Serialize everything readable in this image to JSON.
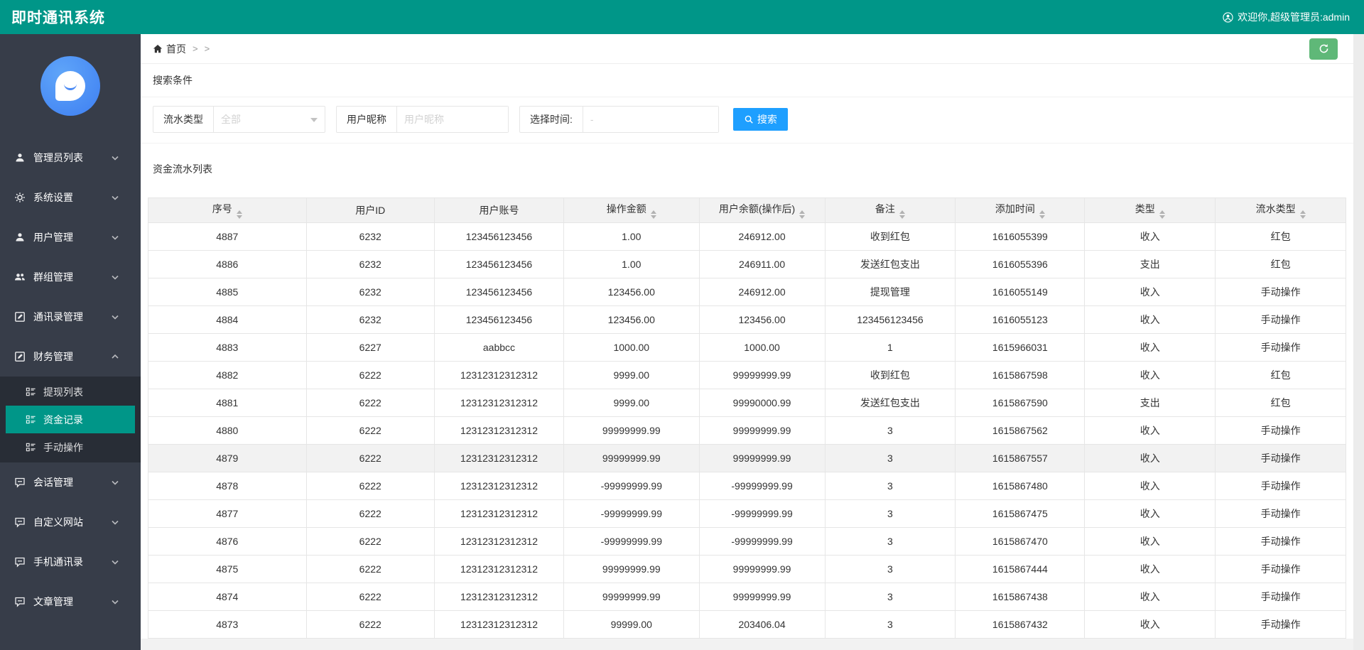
{
  "header": {
    "title": "即时通讯系统",
    "welcome": "欢迎你,超级管理员:admin"
  },
  "sidebar": {
    "menu": [
      {
        "id": "admin-list",
        "label": "管理员列表",
        "icon": "user-icon",
        "state": "collapsed"
      },
      {
        "id": "system-settings",
        "label": "系统设置",
        "icon": "gear-icon",
        "state": "collapsed"
      },
      {
        "id": "user-management",
        "label": "用户管理",
        "icon": "user-icon",
        "state": "collapsed"
      },
      {
        "id": "group-management",
        "label": "群组管理",
        "icon": "users-icon",
        "state": "collapsed"
      },
      {
        "id": "contacts-management",
        "label": "通讯录管理",
        "icon": "edit-icon",
        "state": "collapsed"
      },
      {
        "id": "finance-management",
        "label": "财务管理",
        "icon": "edit-icon",
        "state": "expanded",
        "children": [
          {
            "id": "withdraw-list",
            "label": "提现列表",
            "active": false
          },
          {
            "id": "fund-records",
            "label": "资金记录",
            "active": true
          },
          {
            "id": "manual-operation",
            "label": "手动操作",
            "active": false
          }
        ]
      },
      {
        "id": "session-management",
        "label": "会话管理",
        "icon": "comment-icon",
        "state": "collapsed"
      },
      {
        "id": "custom-website",
        "label": "自定义网站",
        "icon": "comment-icon",
        "state": "collapsed"
      },
      {
        "id": "phone-contacts",
        "label": "手机通讯录",
        "icon": "comment-icon",
        "state": "collapsed"
      },
      {
        "id": "article-management",
        "label": "文章管理",
        "icon": "comment-icon",
        "state": "collapsed"
      }
    ]
  },
  "breadcrumb": {
    "home": "首页",
    "separator": ">"
  },
  "search": {
    "panel_title": "搜索条件",
    "type_label": "流水类型",
    "type_value": "全部",
    "nickname_label": "用户昵称",
    "nickname_placeholder": "用户昵称",
    "time_label": "选择时间:",
    "time_placeholder": "-",
    "button_label": "搜索"
  },
  "table": {
    "title": "资金流水列表",
    "columns": [
      {
        "label": "序号",
        "sortable": true
      },
      {
        "label": "用户ID",
        "sortable": false
      },
      {
        "label": "用户账号",
        "sortable": false
      },
      {
        "label": "操作金额",
        "sortable": true
      },
      {
        "label": "用户余额(操作后)",
        "sortable": true
      },
      {
        "label": "备注",
        "sortable": true
      },
      {
        "label": "添加时间",
        "sortable": true
      },
      {
        "label": "类型",
        "sortable": true
      },
      {
        "label": "流水类型",
        "sortable": true
      }
    ],
    "highlight_row_index": 8,
    "rows": [
      [
        "4887",
        "6232",
        "123456123456",
        "1.00",
        "246912.00",
        "收到红包",
        "1616055399",
        "收入",
        "红包"
      ],
      [
        "4886",
        "6232",
        "123456123456",
        "1.00",
        "246911.00",
        "发送红包支出",
        "1616055396",
        "支出",
        "红包"
      ],
      [
        "4885",
        "6232",
        "123456123456",
        "123456.00",
        "246912.00",
        "提现管理",
        "1616055149",
        "收入",
        "手动操作"
      ],
      [
        "4884",
        "6232",
        "123456123456",
        "123456.00",
        "123456.00",
        "123456123456",
        "1616055123",
        "收入",
        "手动操作"
      ],
      [
        "4883",
        "6227",
        "aabbcc",
        "1000.00",
        "1000.00",
        "1",
        "1615966031",
        "收入",
        "手动操作"
      ],
      [
        "4882",
        "6222",
        "12312312312312",
        "9999.00",
        "99999999.99",
        "收到红包",
        "1615867598",
        "收入",
        "红包"
      ],
      [
        "4881",
        "6222",
        "12312312312312",
        "9999.00",
        "99990000.99",
        "发送红包支出",
        "1615867590",
        "支出",
        "红包"
      ],
      [
        "4880",
        "6222",
        "12312312312312",
        "99999999.99",
        "99999999.99",
        "3",
        "1615867562",
        "收入",
        "手动操作"
      ],
      [
        "4879",
        "6222",
        "12312312312312",
        "99999999.99",
        "99999999.99",
        "3",
        "1615867557",
        "收入",
        "手动操作"
      ],
      [
        "4878",
        "6222",
        "12312312312312",
        "-99999999.99",
        "-99999999.99",
        "3",
        "1615867480",
        "收入",
        "手动操作"
      ],
      [
        "4877",
        "6222",
        "12312312312312",
        "-99999999.99",
        "-99999999.99",
        "3",
        "1615867475",
        "收入",
        "手动操作"
      ],
      [
        "4876",
        "6222",
        "12312312312312",
        "-99999999.99",
        "-99999999.99",
        "3",
        "1615867470",
        "收入",
        "手动操作"
      ],
      [
        "4875",
        "6222",
        "12312312312312",
        "99999999.99",
        "99999999.99",
        "3",
        "1615867444",
        "收入",
        "手动操作"
      ],
      [
        "4874",
        "6222",
        "12312312312312",
        "99999999.99",
        "99999999.99",
        "3",
        "1615867438",
        "收入",
        "手动操作"
      ],
      [
        "4873",
        "6222",
        "12312312312312",
        "99999.00",
        "203406.04",
        "3",
        "1615867432",
        "收入",
        "手动操作"
      ]
    ]
  },
  "colors": {
    "brand_teal": "#009688",
    "sidebar_bg": "#373D49",
    "submenu_bg": "#282D36",
    "active_item_bg": "#009688",
    "search_button_blue": "#1E9FFF",
    "refresh_button_green": "#5FB878",
    "logo_blue": "#4C8BF5",
    "table_border": "#e6e6e6",
    "table_header_bg": "#f2f2f2"
  }
}
